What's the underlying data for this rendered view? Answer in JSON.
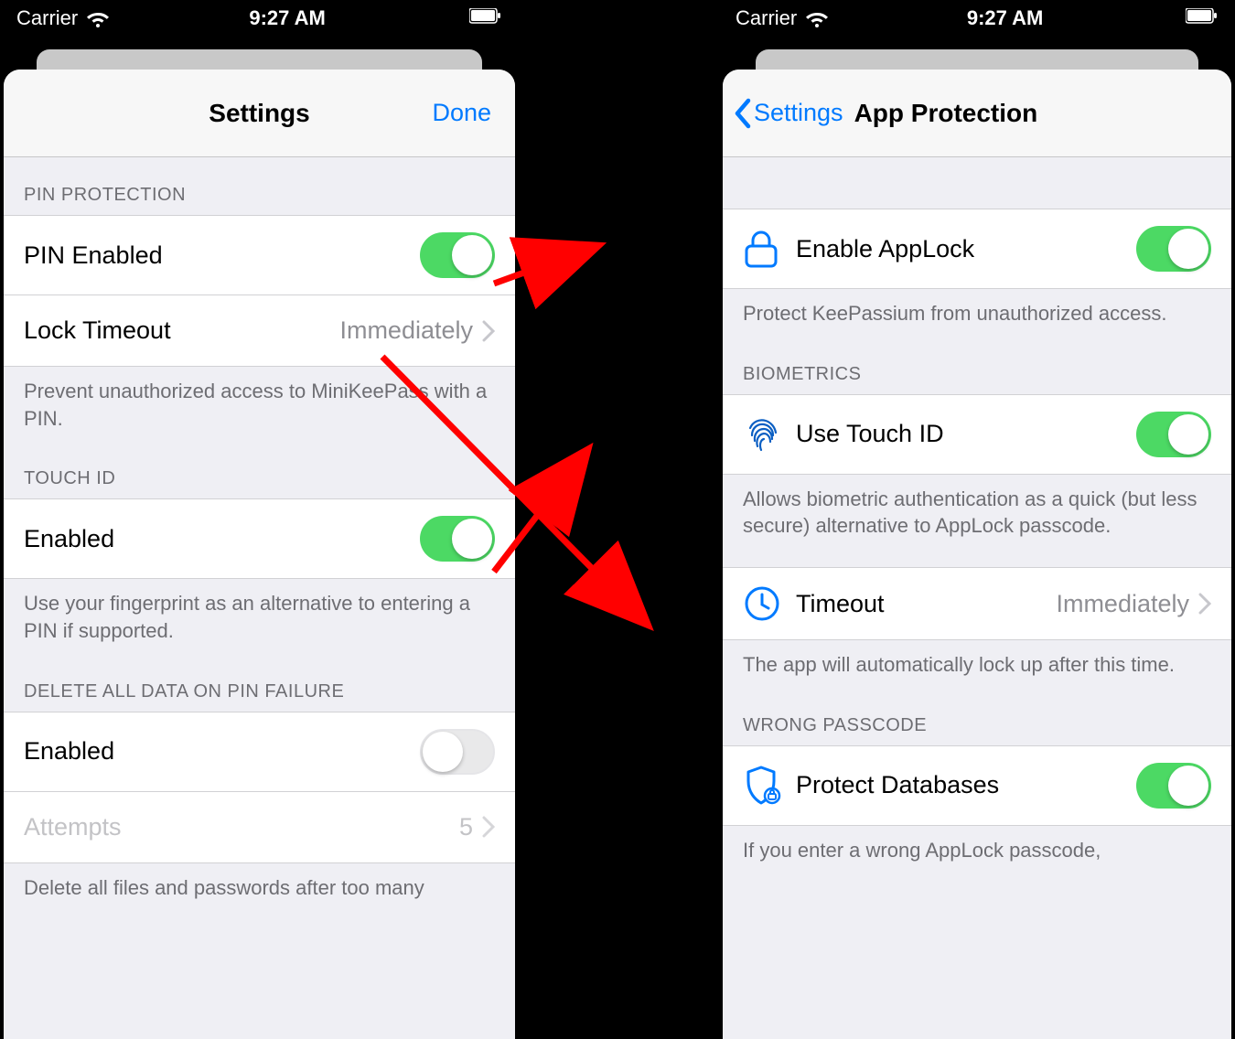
{
  "status": {
    "carrier": "Carrier",
    "time": "9:27 AM"
  },
  "left": {
    "nav": {
      "title": "Settings",
      "done": "Done"
    },
    "pin": {
      "header": "PIN PROTECTION",
      "enabled_label": "PIN Enabled",
      "timeout_label": "Lock Timeout",
      "timeout_value": "Immediately",
      "footer": "Prevent unauthorized access to MiniKeePass with a PIN."
    },
    "touch": {
      "header": "TOUCH ID",
      "enabled_label": "Enabled",
      "footer": "Use your fingerprint as an alternative to entering a PIN if supported."
    },
    "delete": {
      "header": "DELETE ALL DATA ON PIN FAILURE",
      "enabled_label": "Enabled",
      "attempts_label": "Attempts",
      "attempts_value": "5",
      "footer": "Delete all files and passwords after too many"
    }
  },
  "right": {
    "nav": {
      "back": "Settings",
      "title": "App Protection"
    },
    "applock": {
      "label": "Enable AppLock",
      "footer": "Protect KeePassium from unauthorized access."
    },
    "bio": {
      "header": "BIOMETRICS",
      "label": "Use Touch ID",
      "footer": "Allows biometric authentication as a quick (but less secure) alternative to AppLock passcode."
    },
    "timeout": {
      "label": "Timeout",
      "value": "Immediately",
      "footer": "The app will automatically lock up after this time."
    },
    "wrong": {
      "header": "WRONG PASSCODE",
      "label": "Protect Databases",
      "footer": "If you enter a wrong AppLock passcode,"
    }
  }
}
